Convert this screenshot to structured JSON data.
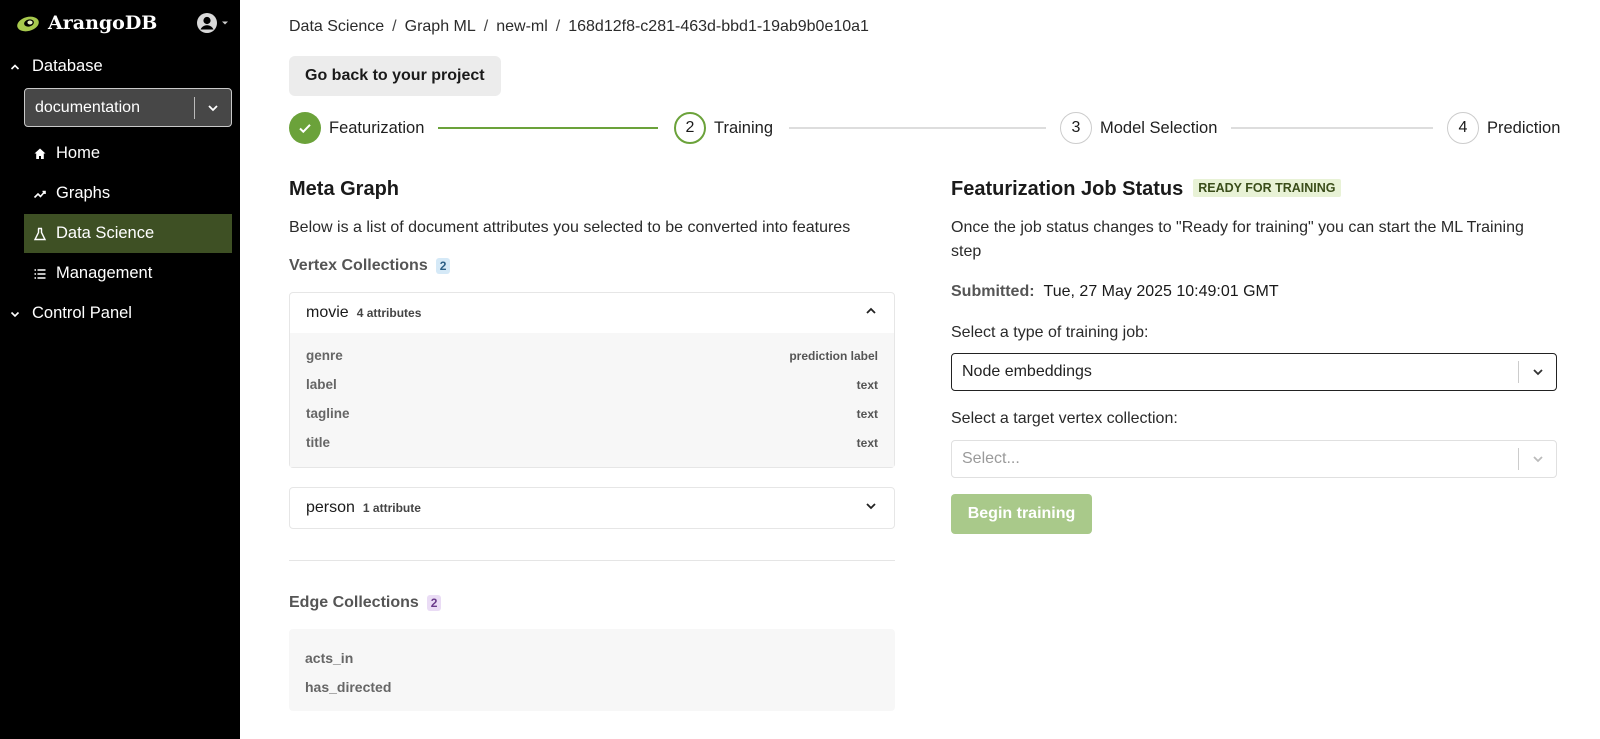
{
  "app": {
    "name": "ArangoDB",
    "brand_color": "#6ba23a"
  },
  "sidebar": {
    "database_section": "Database",
    "database_selected": "documentation",
    "items": [
      {
        "label": "Home",
        "icon": "home-icon"
      },
      {
        "label": "Graphs",
        "icon": "graphs-icon"
      },
      {
        "label": "Data Science",
        "icon": "flask-icon",
        "active": true
      },
      {
        "label": "Management",
        "icon": "list-icon"
      }
    ],
    "control_panel_section": "Control Panel"
  },
  "breadcrumb": [
    "Data Science",
    "Graph ML",
    "new-ml",
    "168d12f8-c281-463d-bbd1-19ab9b0e10a1"
  ],
  "back_button": "Go back to your project",
  "steps": [
    {
      "number": "1",
      "label": "Featurization",
      "state": "complete"
    },
    {
      "number": "2",
      "label": "Training",
      "state": "active"
    },
    {
      "number": "3",
      "label": "Model Selection",
      "state": "pending"
    },
    {
      "number": "4",
      "label": "Prediction",
      "state": "pending"
    }
  ],
  "meta_graph": {
    "title": "Meta Graph",
    "description": "Below is a list of document attributes you selected to be converted into features",
    "vertex_title": "Vertex Collections",
    "vertex_count": "2",
    "vertex_collections": [
      {
        "name": "movie",
        "count_label": "4 attributes",
        "expanded": true,
        "attributes": [
          {
            "name": "genre",
            "type": "prediction label"
          },
          {
            "name": "label",
            "type": "text"
          },
          {
            "name": "tagline",
            "type": "text"
          },
          {
            "name": "title",
            "type": "text"
          }
        ]
      },
      {
        "name": "person",
        "count_label": "1 attribute",
        "expanded": false
      }
    ],
    "edge_title": "Edge Collections",
    "edge_count": "2",
    "edge_collections": [
      "acts_in",
      "has_directed"
    ]
  },
  "job_status": {
    "title": "Featurization Job Status",
    "badge": "READY FOR TRAINING",
    "description": "Once the job status changes to \"Ready for training\" you can start the ML Training step",
    "submitted_label": "Submitted:",
    "submitted_value": "Tue, 27 May 2025 10:49:01 GMT",
    "job_type_label": "Select a type of training job:",
    "job_type_value": "Node embeddings",
    "target_label": "Select a target vertex collection:",
    "target_placeholder": "Select...",
    "begin_button": "Begin training"
  }
}
